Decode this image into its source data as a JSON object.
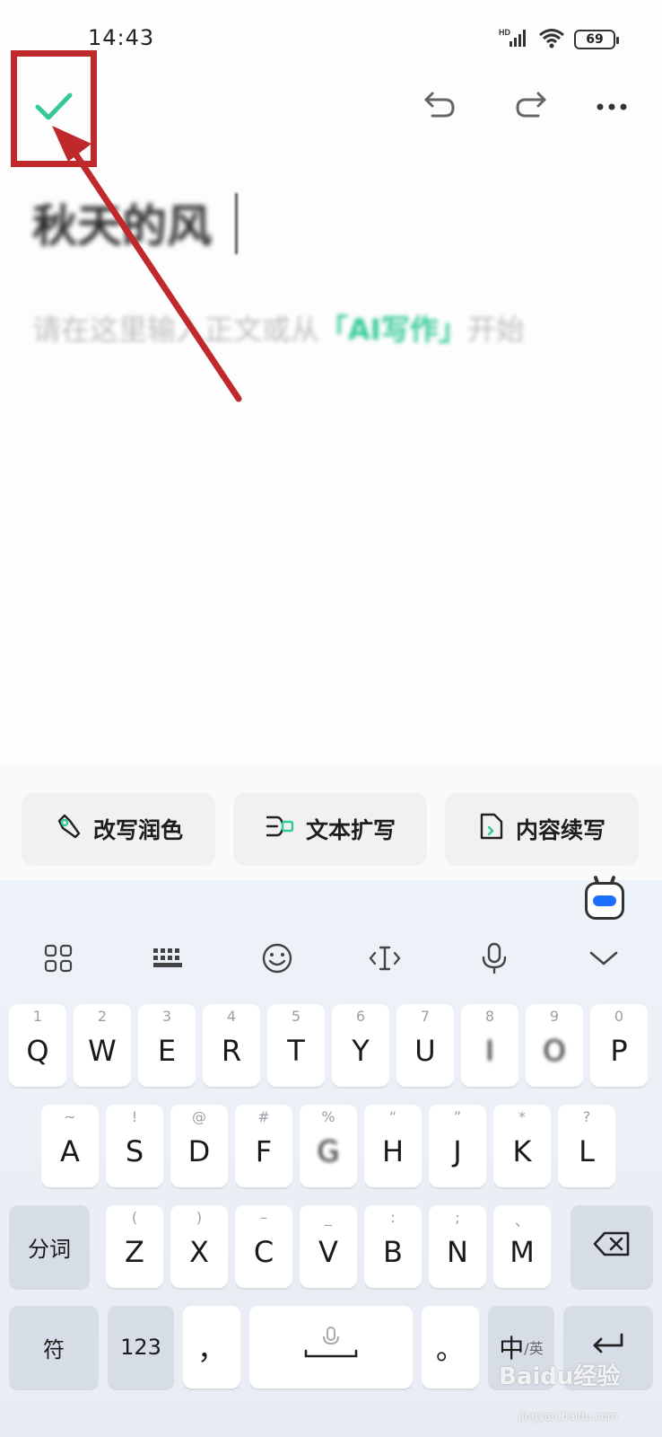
{
  "status_bar": {
    "time": "14:43",
    "network": "HD",
    "battery": "69"
  },
  "toolbar": {
    "done_icon": "check-icon",
    "undo_icon": "undo-icon",
    "redo_icon": "redo-icon",
    "more_icon": "more-icon"
  },
  "editor": {
    "title": "秋天的风",
    "body_placeholder_prefix": "请在这里输入正文或从",
    "body_placeholder_ai": "「AI写作」",
    "body_placeholder_suffix": "开始"
  },
  "ai_actions": [
    {
      "label": "改写润色",
      "icon": "magic-wand-icon"
    },
    {
      "label": "文本扩写",
      "icon": "expand-text-icon"
    },
    {
      "label": "内容续写",
      "icon": "continue-doc-icon"
    }
  ],
  "keyboard": {
    "row1": [
      {
        "hint": "1",
        "key": "Q"
      },
      {
        "hint": "2",
        "key": "W"
      },
      {
        "hint": "3",
        "key": "E"
      },
      {
        "hint": "4",
        "key": "R"
      },
      {
        "hint": "5",
        "key": "T"
      },
      {
        "hint": "6",
        "key": "Y"
      },
      {
        "hint": "7",
        "key": "U"
      },
      {
        "hint": "8",
        "key": "I"
      },
      {
        "hint": "9",
        "key": "O"
      },
      {
        "hint": "0",
        "key": "P"
      }
    ],
    "row2": [
      {
        "hint": "~",
        "key": "A"
      },
      {
        "hint": "!",
        "key": "S"
      },
      {
        "hint": "@",
        "key": "D"
      },
      {
        "hint": "#",
        "key": "F"
      },
      {
        "hint": "%",
        "key": "G"
      },
      {
        "hint": "“",
        "key": "H"
      },
      {
        "hint": "”",
        "key": "J"
      },
      {
        "hint": "*",
        "key": "K"
      },
      {
        "hint": "?",
        "key": "L"
      }
    ],
    "row3": [
      {
        "hint": "(",
        "key": "Z"
      },
      {
        "hint": ")",
        "key": "X"
      },
      {
        "hint": "–",
        "key": "C"
      },
      {
        "hint": "_",
        "key": "V"
      },
      {
        "hint": ":",
        "key": "B"
      },
      {
        "hint": ";",
        "key": "N"
      },
      {
        "hint": "、",
        "key": "M"
      }
    ],
    "split_label": "分词",
    "symbol_label": "符",
    "number_label": "123",
    "comma_label": "，",
    "period_label": "。",
    "lang_main": "中",
    "lang_sub": "/英"
  },
  "watermark": {
    "text": "Baidu经验",
    "sub": "jingyan.baidu.com"
  },
  "colors": {
    "accent_green": "#34c99a",
    "annotation_red": "#c0292b"
  }
}
